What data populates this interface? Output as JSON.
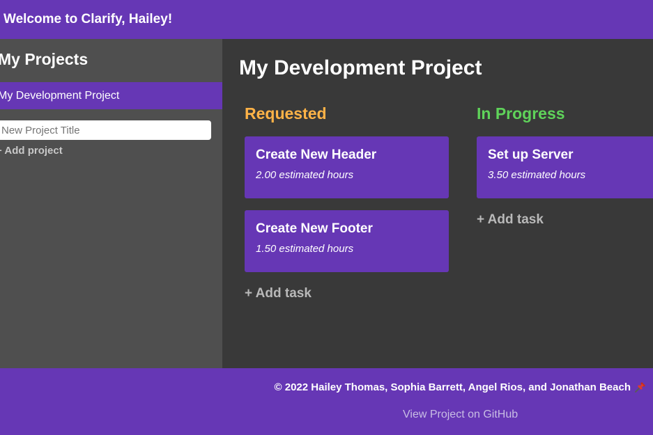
{
  "header": {
    "welcome": "Welcome to Clarify, Hailey!"
  },
  "sidebar": {
    "title": "My Projects",
    "projects": [
      {
        "label": "My Development Project",
        "active": true
      }
    ],
    "new_project_placeholder": "New Project Title",
    "add_project_label": "+ Add project"
  },
  "main": {
    "title": "My Development Project",
    "columns": [
      {
        "title": "Requested",
        "color": "#ffb347",
        "tasks": [
          {
            "title": "Create New Header",
            "hours": "2.00 estimated hours"
          },
          {
            "title": "Create New Footer",
            "hours": "1.50 estimated hours"
          }
        ],
        "add_task_label": "+ Add task"
      },
      {
        "title": "In Progress",
        "color": "#5fd35a",
        "tasks": [
          {
            "title": "Set up Server",
            "hours": "3.50 estimated hours"
          }
        ],
        "add_task_label": "+ Add task"
      }
    ]
  },
  "footer": {
    "copyright": "© 2022 Hailey Thomas, Sophia Barrett, Angel Rios, and Jonathan Beach",
    "icon": "pushpin-icon",
    "github_link": "View Project on GitHub"
  },
  "colors": {
    "brand_purple": "#6637b5",
    "sidebar_bg": "#4f4f4f",
    "main_bg": "#393939"
  }
}
